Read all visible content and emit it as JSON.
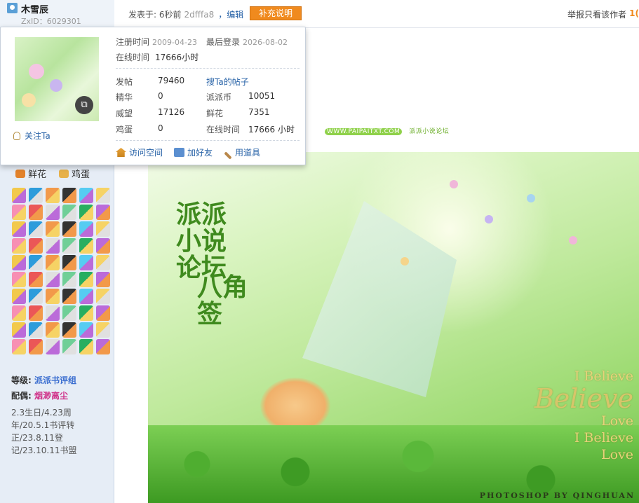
{
  "user": {
    "name": "木雪辰",
    "zxid": "ZxID：6029301"
  },
  "header": {
    "posted": "发表于: 6秒前",
    "hash": "2dfffa8",
    "edit": "，编辑",
    "supplement_btn": "补充说明",
    "report": "举报",
    "only_author": "只看该作者",
    "floor_num": "1("
  },
  "popup": {
    "reg_label": "注册时间",
    "reg_value": "2009-04-23",
    "last_login_label": "最后登录",
    "last_login_value": "2026-08-02",
    "online_label": "在线时间",
    "online_value": "17666小时",
    "follow": "关注Ta",
    "stats": {
      "posts_k": "发帖",
      "posts_v": "79460",
      "search_link": "搜Ta的帖子",
      "essence_k": "精华",
      "essence_v": "0",
      "coin_k": "派派币",
      "coin_v": "10051",
      "prestige_k": "威望",
      "prestige_v": "17126",
      "flower_k": "鲜花",
      "flower_v": "7351",
      "egg_k": "鸡蛋",
      "egg_v": "0",
      "online2_k": "在线时间",
      "online2_v": "17666 小时"
    },
    "actions": {
      "visit": "访问空间",
      "add_friend": "加好友",
      "use_tool": "用道具"
    }
  },
  "sidebar": {
    "flower": "鲜花",
    "egg": "鸡蛋",
    "rank_label": "等级:",
    "rank_value": "派派书评组",
    "partner_label": "配偶:",
    "partner_value": "烟渺离尘",
    "bio": "2.3生日/4.23周年/20.5.1书评转正/23.8.11登记/23.10.11书盟"
  },
  "signature_strip": {
    "site": "WWW.PAIPAITXT.COM",
    "forum": "派派小说论坛"
  },
  "banner": {
    "calligraphy": [
      "派派",
      "小说",
      "论坛"
    ],
    "calligraphy2": "八角签",
    "eng_lines": [
      "I Believe",
      "Believe",
      "Love",
      "I Believe",
      "Love"
    ],
    "credit": "PHOTOSHOP BY QINGHUAN"
  },
  "colors": {
    "accent": "#f08a1e",
    "link": "#2a64a8",
    "sidebar_bg": "#e6edf6"
  }
}
